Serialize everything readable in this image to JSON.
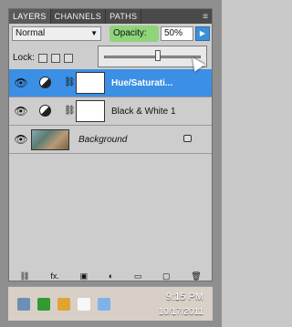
{
  "tabs": [
    {
      "label": "LAYERS"
    },
    {
      "label": "CHANNELS"
    },
    {
      "label": "PATHS"
    }
  ],
  "blend_mode": {
    "value": "Normal"
  },
  "opacity": {
    "label": "Opacity:",
    "value": "50%"
  },
  "lock": {
    "label": "Lock:"
  },
  "layers": [
    {
      "name": "Hue/Saturati...",
      "selected": true,
      "type": "adjustment"
    },
    {
      "name": "Black & White 1",
      "selected": false,
      "type": "adjustment"
    },
    {
      "name": "Background",
      "selected": false,
      "type": "image"
    }
  ],
  "footer": {
    "items": [
      "link-icon",
      "fx-icon",
      "mask-icon",
      "adjustment-icon",
      "folder-icon",
      "new-layer-icon",
      "trash-icon"
    ]
  },
  "taskbar": {
    "time": "9:15 PM",
    "date": "10/17/2011"
  },
  "colors": {
    "selection": "#3b8fe4",
    "opacity_highlight": "#8fd37a"
  }
}
